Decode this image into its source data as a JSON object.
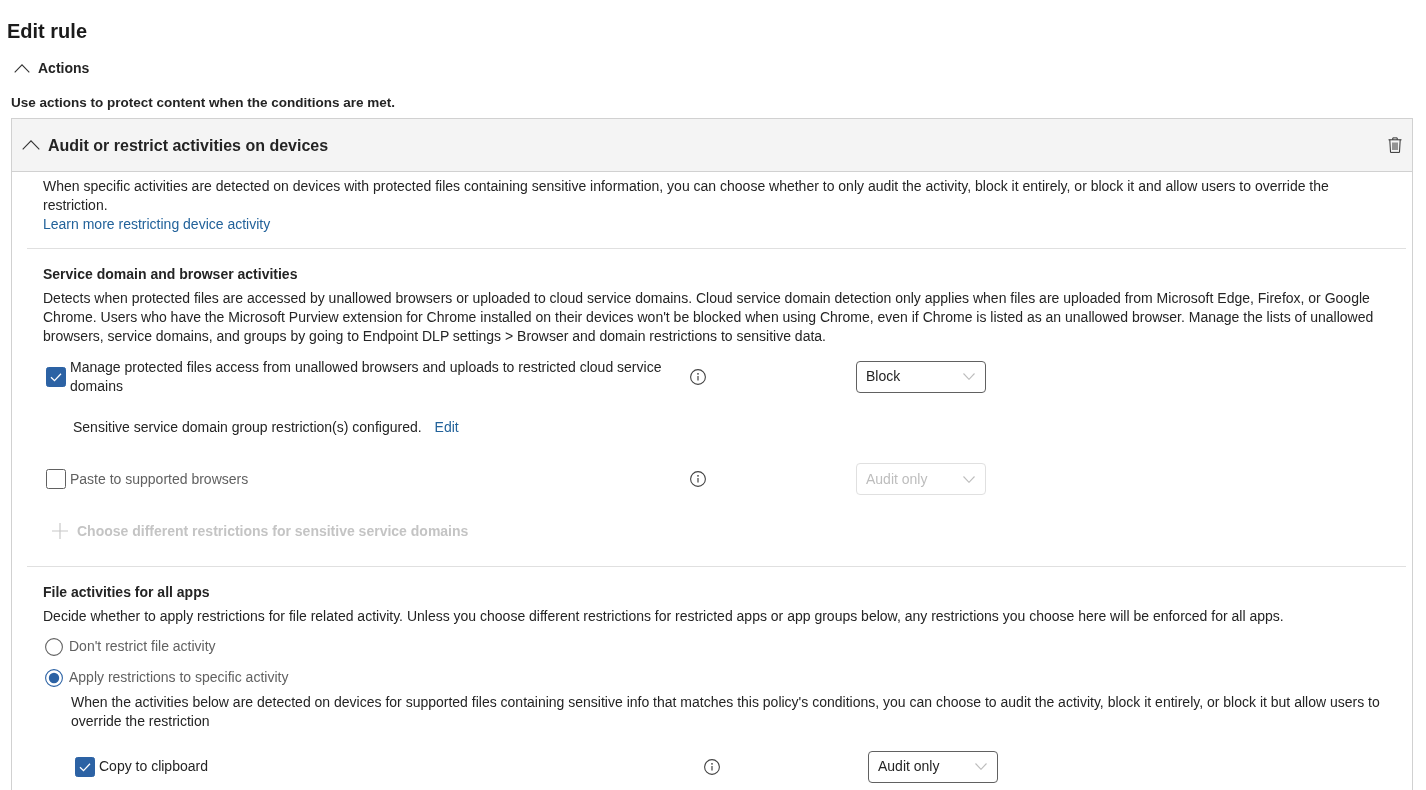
{
  "page": {
    "title": "Edit rule"
  },
  "actions_group": {
    "label": "Actions",
    "expanded": true,
    "description": "Use actions to protect content when the conditions are met."
  },
  "action_card": {
    "title": "Audit or restrict activities on devices",
    "expanded": true,
    "description": "When specific activities are detected on devices with protected files containing sensitive information, you can choose whether to only audit the activity, block it entirely, or block it and allow users to override the restriction.",
    "link": "Learn more restricting device activity",
    "sections": [
      {
        "kind": "checkbox_list",
        "heading": "Service domain and browser activities",
        "description": "Detects when protected files are accessed by unallowed browsers or uploaded to cloud service domains. Cloud service domain detection only applies when files are uploaded from Microsoft Edge, Firefox, or Google Chrome. Users who have the Microsoft Purview extension for Chrome installed on their devices won't be blocked when using Chrome, even if Chrome is listed as an unallowed browser. Manage the lists of unallowed browsers, service domains, and groups by going to Endpoint DLP settings > Browser and domain restrictions to sensitive data.",
        "items": [
          {
            "label": "Manage protected files access from unallowed browsers and uploads to restricted cloud service domains",
            "checked": true,
            "action": "Block",
            "note": "Sensitive service domain group restriction(s) configured.",
            "note_link": "Edit"
          },
          {
            "label": "Paste to supported browsers",
            "checked": false,
            "action": "Audit only"
          }
        ],
        "add_button": {
          "label": "Choose different restrictions for sensitive service domains",
          "disabled": true
        }
      },
      {
        "kind": "radio_group",
        "heading": "File activities for all apps",
        "description": "Decide whether to apply restrictions for file related activity. Unless you choose different restrictions for restricted apps or app groups below, any restrictions you choose here will be enforced for all apps.",
        "options": [
          {
            "label": "Don't restrict file activity",
            "selected": false
          },
          {
            "label": "Apply restrictions to specific activity",
            "selected": true,
            "description": "When the activities below are detected on devices for supported files containing sensitive info that matches this policy's conditions, you can choose to audit the activity, block it entirely, or block it but allow users to override the restriction",
            "items": [
              {
                "label": "Copy to clipboard",
                "checked": true,
                "action": "Audit only"
              }
            ]
          }
        ]
      }
    ]
  }
}
